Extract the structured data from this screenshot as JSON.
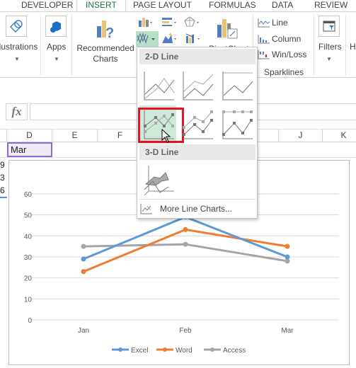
{
  "ribbon_tabs": [
    "DEVELOPER",
    "INSERT",
    "PAGE LAYOUT",
    "FORMULAS",
    "DATA",
    "REVIEW"
  ],
  "active_tab": "INSERT",
  "ribbon": {
    "illustrations": "llustrations",
    "apps": "Apps",
    "recommended_charts_1": "Recommended",
    "recommended_charts_2": "Charts",
    "pivotchart": "PivotChart",
    "sparkline_line": "Line",
    "sparkline_column": "Column",
    "sparkline_winloss": "Win/Loss",
    "sparklines_group": "Sparklines",
    "filters": "Filters",
    "h_partial": "H"
  },
  "formula_bar": {
    "fx": "fx",
    "value": ""
  },
  "columns": [
    "D",
    "E",
    "F",
    "J",
    "K"
  ],
  "cells": {
    "d_header_row": "Mar",
    "left_values": [
      "9",
      "3",
      "6"
    ]
  },
  "line_menu": {
    "section_2d": "2-D Line",
    "section_3d": "3-D Line",
    "more": "More Line Charts...",
    "highlighted_item": "Line with Markers"
  },
  "colors": {
    "excel": "#5b9bd5",
    "word": "#ed7d31",
    "access": "#a5a5a5",
    "accent": "#217346",
    "highlight": "#cfe9d9",
    "selection_box": "#e81123"
  },
  "chart_data": {
    "type": "line",
    "categories": [
      "Jan",
      "Feb",
      "Mar"
    ],
    "series": [
      {
        "name": "Excel",
        "values": [
          29,
          49,
          30
        ]
      },
      {
        "name": "Word",
        "values": [
          23,
          43,
          35
        ]
      },
      {
        "name": "Access",
        "values": [
          35,
          36,
          28
        ]
      }
    ],
    "yticks": [
      "0",
      "10",
      "20",
      "30",
      "40",
      "50",
      "60"
    ],
    "ylim": [
      0,
      60
    ],
    "grid": true,
    "legend": "bottom",
    "markers": true
  }
}
